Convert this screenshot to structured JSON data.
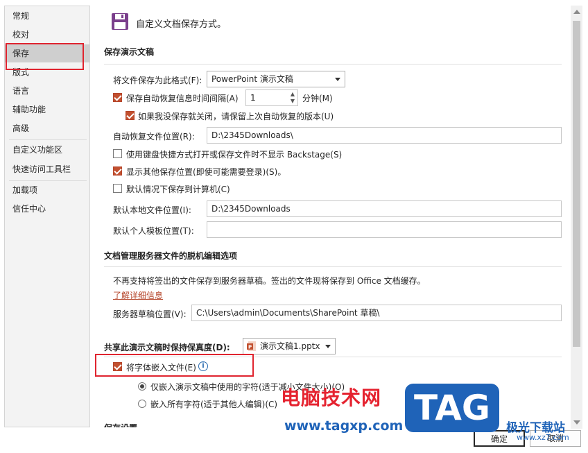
{
  "sidebar": {
    "items": [
      {
        "label": "常规"
      },
      {
        "label": "校对"
      },
      {
        "label": "保存"
      },
      {
        "label": "版式"
      },
      {
        "label": "语言"
      },
      {
        "label": "辅助功能"
      },
      {
        "label": "高级"
      },
      {
        "label": "自定义功能区"
      },
      {
        "label": "快速访问工具栏"
      },
      {
        "label": "加载项"
      },
      {
        "label": "信任中心"
      }
    ]
  },
  "header": {
    "icon": "save-icon",
    "title": "自定义文档保存方式。"
  },
  "save_presentations": {
    "title": "保存演示文稿",
    "format_label": "将文件保存为此格式(F):",
    "format_value": "PowerPoint 演示文稿",
    "autorecover_label": "保存自动恢复信息时间间隔(A)",
    "autorecover_checked": true,
    "autorecover_minutes": "1",
    "minutes_unit": "分钟(M)",
    "keep_last_label": "如果我没保存就关闭，请保留上次自动恢复的版本(U)",
    "keep_last_checked": true,
    "autorecover_location_label": "自动恢复文件位置(R):",
    "autorecover_location_value": "D:\\2345Downloads\\",
    "no_backstage_label": "使用键盘快捷方式打开或保存文件时不显示 Backstage(S)",
    "no_backstage_checked": false,
    "show_other_locations_label": "显示其他保存位置(即使可能需要登录)(S)。",
    "show_other_locations_checked": true,
    "save_to_computer_label": "默认情况下保存到计算机(C)",
    "save_to_computer_checked": false,
    "local_location_label": "默认本地文件位置(I):",
    "local_location_value": "D:\\2345Downloads",
    "template_location_label": "默认个人模板位置(T):",
    "template_location_value": ""
  },
  "offline_editing": {
    "title": "文档管理服务器文件的脱机编辑选项",
    "info_text": "不再支持将签出的文件保存到服务器草稿。签出的文件现将保存到 Office 文档缓存。",
    "learn_more": "了解详细信息",
    "drafts_label": "服务器草稿位置(V):",
    "drafts_value": "C:\\Users\\admin\\Documents\\SharePoint 草稿\\"
  },
  "fidelity": {
    "title": "共享此演示文稿时保持保真度(D):",
    "doc_value": "演示文稿1.pptx",
    "embed_fonts_label": "将字体嵌入文件(E)",
    "embed_fonts_checked": true,
    "embed_used_label": "仅嵌入演示文稿中使用的字符(适于减小文件大小)(O)",
    "embed_used_checked": true,
    "embed_all_label": "嵌入所有字符(适于其他人编辑)(C)",
    "embed_all_checked": false
  },
  "cut_section": {
    "title": "保存设置"
  },
  "footer": {
    "ok_label": "确定",
    "cancel_label": "取消"
  },
  "watermark": {
    "site_name": "电脑技术网",
    "site_url": "www.tagxp.com",
    "tag_text": "TAG",
    "brand": "极光下载站",
    "brand_url": "www.xz7.com"
  },
  "colors": {
    "checkbox_checked": "#c2502f",
    "highlight_box": "#e0242f",
    "link": "#b5452a"
  }
}
